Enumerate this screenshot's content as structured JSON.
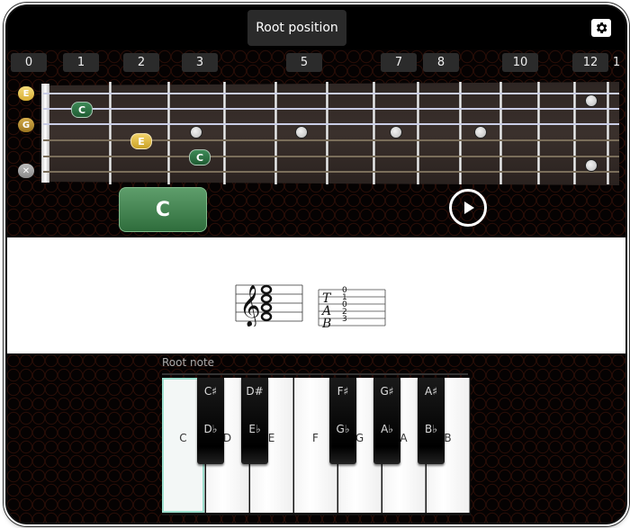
{
  "header": {
    "position_label": "Root position",
    "settings_icon": "gear-icon"
  },
  "fret_numbers": [
    "0",
    "1",
    "2",
    "3",
    "5",
    "7",
    "8",
    "10",
    "12",
    "1"
  ],
  "open_strings": [
    {
      "label": "E",
      "color": "#e8c34f"
    },
    {
      "label": "G",
      "color": "#b8922f"
    },
    {
      "label": "✕",
      "color": "#9a9a9a"
    }
  ],
  "fretted_notes": [
    {
      "label": "C",
      "type": "root"
    },
    {
      "label": "E",
      "type": "third"
    },
    {
      "label": "C",
      "type": "root"
    }
  ],
  "chord": {
    "name": "C",
    "play_icon": "play-icon"
  },
  "notation": {
    "tab_letters": [
      "T",
      "A",
      "B"
    ],
    "tab_numbers": [
      "0",
      "1",
      "0",
      "2",
      "3"
    ]
  },
  "piano": {
    "title": "Root note",
    "selected": "C",
    "white_keys": [
      "C",
      "D",
      "E",
      "F",
      "G",
      "A",
      "B"
    ],
    "black_keys": [
      {
        "sharp": "C♯",
        "flat": "D♭"
      },
      {
        "sharp": "D#",
        "flat": "E♭"
      },
      {
        "sharp": "F♯",
        "flat": "G♭"
      },
      {
        "sharp": "G♯",
        "flat": "A♭"
      },
      {
        "sharp": "A♯",
        "flat": "B♭"
      }
    ]
  },
  "colors": {
    "root_note": "#2f7a47",
    "third_note": "#e8c34f",
    "selected_key_outline": "#9ee0cf"
  }
}
